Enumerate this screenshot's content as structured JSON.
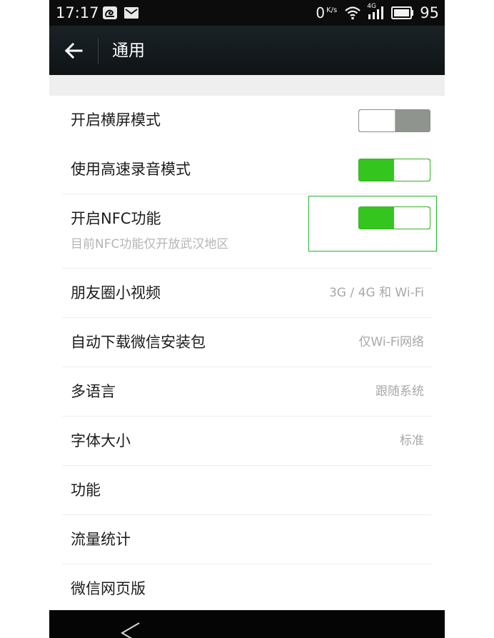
{
  "status_bar": {
    "time": "17:17",
    "net_speed": "0",
    "net_unit": "K/s",
    "network_type": "4G",
    "battery": "95",
    "icons": [
      "uc-browser-icon",
      "mail-icon",
      "wifi-icon",
      "cell-signal-icon",
      "battery-icon"
    ]
  },
  "title_bar": {
    "title": "通用",
    "back_icon": "back-arrow-icon"
  },
  "settings": {
    "landscape": {
      "label": "开启横屏模式",
      "toggle_on": false
    },
    "fast_record": {
      "label": "使用高速录音模式",
      "toggle_on": true
    },
    "nfc": {
      "label": "开启NFC功能",
      "sub": "目前NFC功能仅开放武汉地区",
      "toggle_on": true
    },
    "moments_video": {
      "label": "朋友圈小视频",
      "value": "3G / 4G 和 Wi-Fi"
    },
    "auto_download": {
      "label": "自动下载微信安装包",
      "value": "仅Wi-Fi网络"
    },
    "language": {
      "label": "多语言",
      "value": "跟随系统"
    },
    "font_size": {
      "label": "字体大小",
      "value": "标准"
    },
    "features": {
      "label": "功能"
    },
    "data_usage": {
      "label": "流量统计"
    },
    "web_wechat": {
      "label": "微信网页版"
    }
  },
  "colors": {
    "toggle_on": "#34c61f",
    "toggle_off": "#8f948f",
    "focus": "#24b430",
    "title_bar": "#141b1e"
  },
  "nav_bar": {
    "icons": [
      "nav-back-icon"
    ]
  }
}
